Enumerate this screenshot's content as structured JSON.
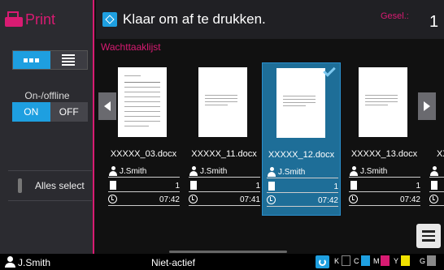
{
  "sidebar": {
    "app_title": "Print",
    "online_label": "On-/offline",
    "on_label": "ON",
    "off_label": "OFF",
    "select_all_label": "Alles select"
  },
  "header": {
    "status_text": "Klaar om af te drukken.",
    "selected_label": "Gesel.:",
    "selected_count": "1"
  },
  "queue_label": "Wachttaaklijst",
  "jobs": [
    {
      "filename": "XXXXX_03.docx",
      "user": "J.Smith",
      "pages": "1",
      "time": "07:42",
      "selected": false
    },
    {
      "filename": "XXXXX_11.docx",
      "user": "J.Smith",
      "pages": "1",
      "time": "07:41",
      "selected": false
    },
    {
      "filename": "XXXXX_12.docx",
      "user": "J.Smith",
      "pages": "1",
      "time": "07:42",
      "selected": true
    },
    {
      "filename": "XXXXX_13.docx",
      "user": "J.Smith",
      "pages": "1",
      "time": "07:42",
      "selected": false
    },
    {
      "filename": "XX",
      "user": "",
      "pages": "",
      "time": "",
      "selected": false
    }
  ],
  "status_bar": {
    "user": "J.Smith",
    "status": "Niet-actief",
    "inks": [
      {
        "label": "K",
        "color": "#000000"
      },
      {
        "label": "C",
        "color": "#1e9fe0"
      },
      {
        "label": "M",
        "color": "#d81b72"
      },
      {
        "label": "Y",
        "color": "#f2e200"
      },
      {
        "label": "G",
        "color": "#888888"
      }
    ]
  },
  "accent_colors": {
    "brand": "#d81b72",
    "accent": "#1e9fe0"
  }
}
